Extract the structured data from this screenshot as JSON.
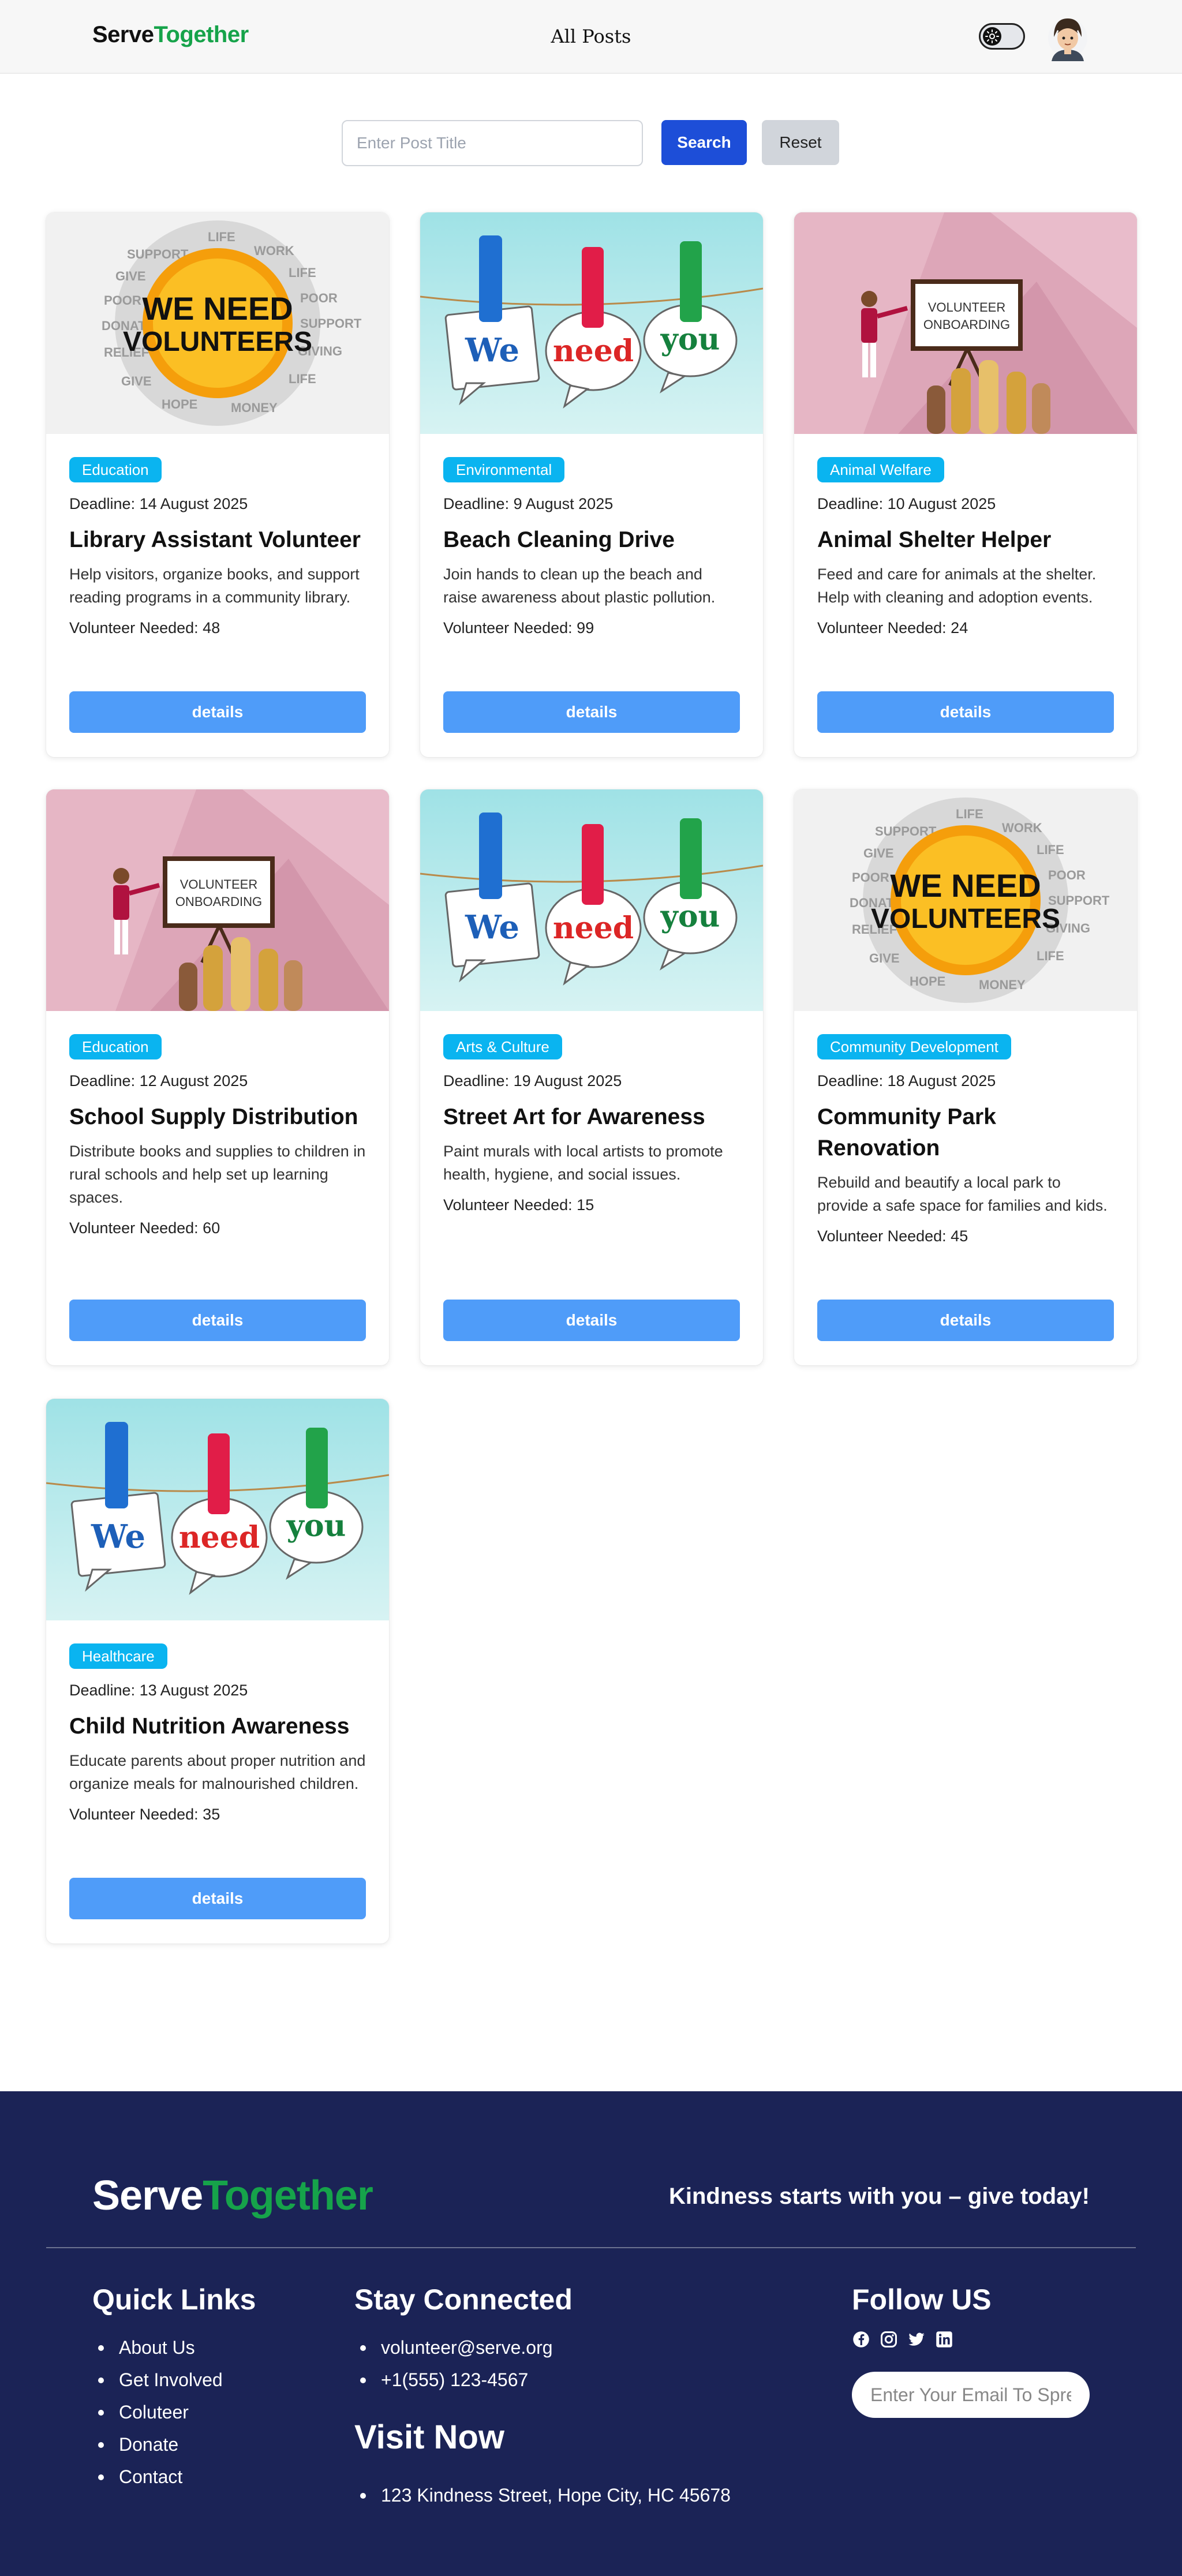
{
  "nav": {
    "brand_serve": "Serve",
    "brand_together": "Together",
    "center_link": "All Posts",
    "theme_toggle_icon": "sun-icon",
    "avatar_icon": "user-avatar"
  },
  "search": {
    "placeholder": "Enter Post Title",
    "value": "",
    "search_label": "Search",
    "reset_label": "Reset"
  },
  "colors": {
    "brand_green": "#16a34a",
    "badge": "#0ab4f0",
    "details_button": "#4f9cf9",
    "search_button": "#1d4ed8",
    "footer_bg": "#1b2356"
  },
  "posts": [
    {
      "image": "we-need-volunteers-image",
      "category": "Education",
      "deadline": "Deadline: 14 August 2025",
      "title": "Library Assistant Volunteer",
      "description": "Help visitors, organize books, and support reading programs in a community library.",
      "needed": "Volunteer Needed: 48",
      "button": "details"
    },
    {
      "image": "we-need-you-image",
      "category": "Environmental",
      "deadline": "Deadline: 9 August 2025",
      "title": "Beach Cleaning Drive",
      "description": "Join hands to clean up the beach and raise awareness about plastic pollution.",
      "needed": "Volunteer Needed: 99",
      "button": "details"
    },
    {
      "image": "volunteer-onboarding-image",
      "category": "Animal Welfare",
      "deadline": "Deadline: 10 August 2025",
      "title": "Animal Shelter Helper",
      "description": "Feed and care for animals at the shelter. Help with cleaning and adoption events.",
      "needed": "Volunteer Needed: 24",
      "button": "details"
    },
    {
      "image": "volunteer-onboarding-image",
      "category": "Education",
      "deadline": "Deadline: 12 August 2025",
      "title": "School Supply Distribution",
      "description": "Distribute books and supplies to children in rural schools and help set up learning spaces.",
      "needed": "Volunteer Needed: 60",
      "button": "details"
    },
    {
      "image": "we-need-you-image",
      "category": "Arts & Culture",
      "deadline": "Deadline: 19 August 2025",
      "title": "Street Art for Awareness",
      "description": "Paint murals with local artists to promote health, hygiene, and social issues.",
      "needed": "Volunteer Needed: 15",
      "button": "details"
    },
    {
      "image": "we-need-volunteers-image",
      "category": "Community Development",
      "deadline": "Deadline: 18 August 2025",
      "title": "Community Park Renovation",
      "description": "Rebuild and beautify a local park to provide a safe space for families and kids.",
      "needed": "Volunteer Needed: 45",
      "button": "details"
    },
    {
      "image": "we-need-you-image",
      "category": "Healthcare",
      "deadline": "Deadline: 13 August 2025",
      "title": "Child Nutrition Awareness",
      "description": "Educate parents about proper nutrition and organize meals for malnourished children.",
      "needed": "Volunteer Needed: 35",
      "button": "details"
    }
  ],
  "image_text": {
    "we_need": "WE NEED",
    "volunteers": "VOLUNTEERS",
    "we": "We",
    "need": "need",
    "you": "you",
    "onboarding_line1": "VOLUNTEER",
    "onboarding_line2": "ONBOARDING"
  },
  "footer": {
    "brand_serve": "Serve",
    "brand_together": "Together",
    "tagline": "Kindness starts with you – give today!",
    "quick_links_title": "Quick Links",
    "quick_links": [
      "About Us",
      "Get Involved",
      "Coluteer",
      "Donate",
      "Contact"
    ],
    "stay_connected_title": "Stay Connected",
    "contacts": [
      "volunteer@serve.org",
      "+1(555) 123-4567"
    ],
    "visit_title": "Visit Now",
    "address": "123 Kindness Street, Hope City, HC 45678",
    "follow_title": "Follow US",
    "social_icons": [
      "facebook-icon",
      "instagram-icon",
      "twitter-icon",
      "linkedin-icon"
    ],
    "email_placeholder": "Enter Your Email To Spread Kindness"
  }
}
